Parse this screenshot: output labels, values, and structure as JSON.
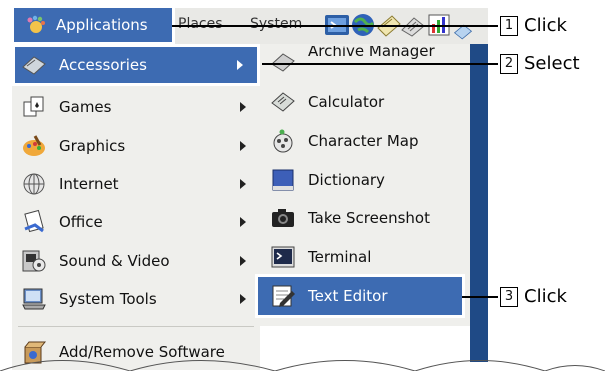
{
  "panel": {
    "applications_label": "Applications",
    "places_label": "Places",
    "system_label": "System",
    "launchers": [
      "terminal-icon",
      "globe-icon",
      "mail-icon",
      "notes-icon",
      "chart-icon",
      "help-icon"
    ]
  },
  "applications_menu": {
    "items": [
      {
        "label": "Accessories",
        "icon": "accessories-icon",
        "submenu": true,
        "selected": true
      },
      {
        "label": "Games",
        "icon": "games-icon",
        "submenu": true
      },
      {
        "label": "Graphics",
        "icon": "graphics-icon",
        "submenu": true
      },
      {
        "label": "Internet",
        "icon": "internet-icon",
        "submenu": true
      },
      {
        "label": "Office",
        "icon": "office-icon",
        "submenu": true
      },
      {
        "label": "Sound & Video",
        "icon": "sound-video-icon",
        "submenu": true
      },
      {
        "label": "System Tools",
        "icon": "system-tools-icon",
        "submenu": true
      }
    ],
    "footer_item": {
      "label": "Add/Remove Software",
      "icon": "add-remove-icon"
    }
  },
  "accessories_menu": {
    "items": [
      {
        "label": "Archive Manager",
        "icon": "archive-icon"
      },
      {
        "label": "Calculator",
        "icon": "calculator-icon"
      },
      {
        "label": "Character Map",
        "icon": "character-map-icon"
      },
      {
        "label": "Dictionary",
        "icon": "dictionary-icon"
      },
      {
        "label": "Take Screenshot",
        "icon": "camera-icon"
      },
      {
        "label": "Terminal",
        "icon": "terminal-icon"
      },
      {
        "label": "Text Editor",
        "icon": "text-editor-icon",
        "selected": true
      }
    ]
  },
  "callouts": [
    {
      "number": "1",
      "action": "Click"
    },
    {
      "number": "2",
      "action": "Select"
    },
    {
      "number": "3",
      "action": "Click"
    }
  ],
  "colors": {
    "selection": "#3d6bb2",
    "menu_bg": "#efefec",
    "desktop": "#1f4a86"
  }
}
